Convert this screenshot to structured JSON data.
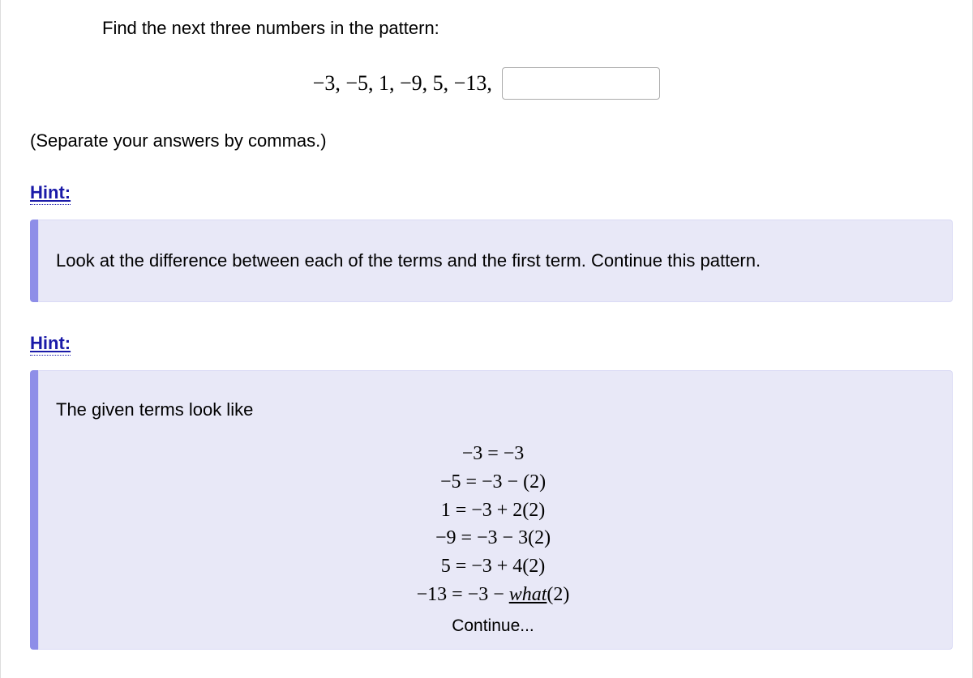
{
  "question": {
    "prompt": "Find the next three numbers in the pattern:",
    "sequence": "−3, −5, 1, −9, 5, −13,",
    "input_value": "",
    "separate_note": "(Separate your answers by commas.)"
  },
  "hints": [
    {
      "label": "Hint:",
      "body": "Look at the difference between each of the terms and the first term. Continue this pattern."
    },
    {
      "label": "Hint:",
      "intro": "The given terms look like",
      "equations": [
        "−3 = −3",
        "−5 = −3 − (2)",
        "1 = −3 + 2(2)",
        "−9 = −3 − 3(2)",
        "5 = −3 + 4(2)"
      ],
      "eq_last_prefix": "−13 = −3 − ",
      "eq_last_what": "what",
      "eq_last_suffix": "(2)",
      "continue": "Continue..."
    }
  ]
}
